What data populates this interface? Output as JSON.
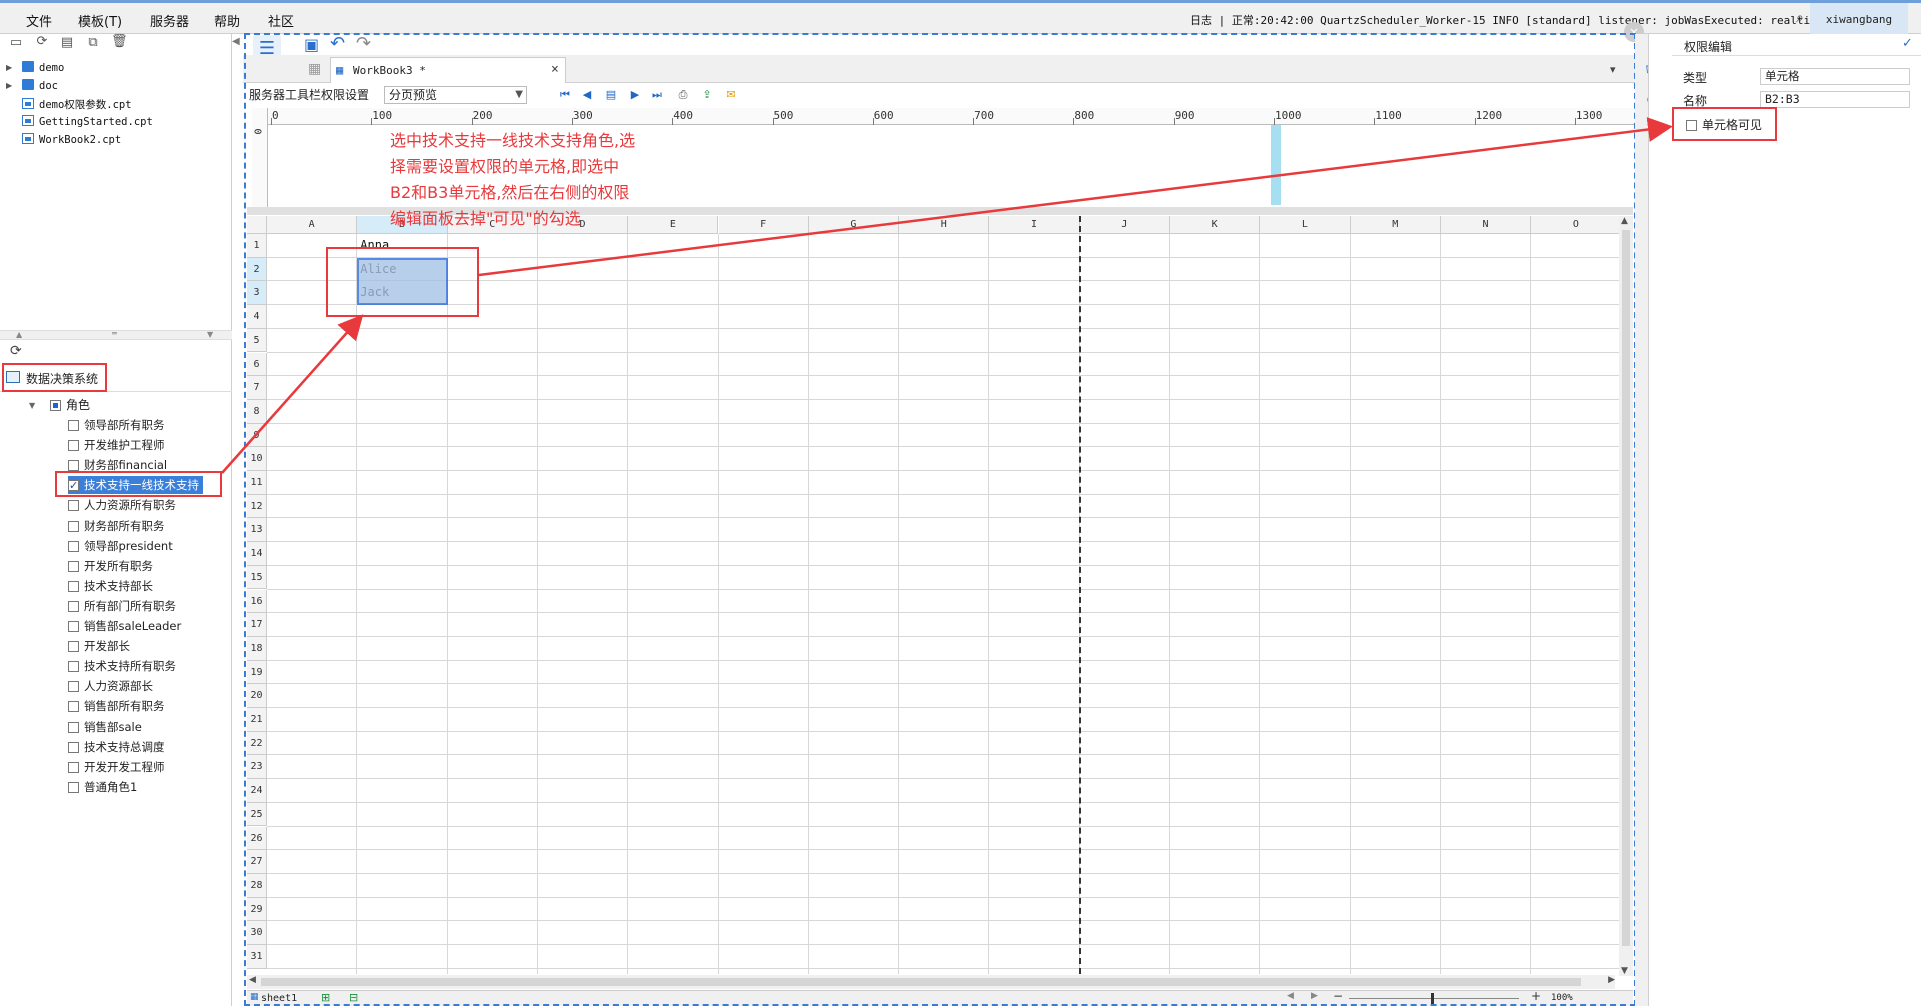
{
  "menu": [
    "文件",
    "模板(T)",
    "服务器",
    "帮助",
    "社区"
  ],
  "log": "日志 | 正常:20:42:00 QuartzScheduler_Worker-15 INFO [standard] listener: jobWasExecuted: realtime...",
  "user": "xiwangbang",
  "files": [
    {
      "name": "demo",
      "kind": "folder"
    },
    {
      "name": "doc",
      "kind": "folder"
    },
    {
      "name": "demo权限参数.cpt",
      "kind": "cpt"
    },
    {
      "name": "GettingStarted.cpt",
      "kind": "cpt"
    },
    {
      "name": "WorkBook2.cpt",
      "kind": "cpt"
    }
  ],
  "decision_system": "数据决策系统",
  "roles_root": "角色",
  "roles": [
    {
      "label": "领导部所有职务",
      "checked": false
    },
    {
      "label": "开发维护工程师",
      "checked": false
    },
    {
      "label": "财务部financial",
      "checked": false
    },
    {
      "label": "技术支持一线技术支持",
      "checked": true
    },
    {
      "label": "人力资源所有职务",
      "checked": false
    },
    {
      "label": "财务部所有职务",
      "checked": false
    },
    {
      "label": "领导部president",
      "checked": false
    },
    {
      "label": "开发所有职务",
      "checked": false
    },
    {
      "label": "技术支持部长",
      "checked": false
    },
    {
      "label": "所有部门所有职务",
      "checked": false
    },
    {
      "label": "销售部saleLeader",
      "checked": false
    },
    {
      "label": "开发部长",
      "checked": false
    },
    {
      "label": "技术支持所有职务",
      "checked": false
    },
    {
      "label": "人力资源部长",
      "checked": false
    },
    {
      "label": "销售部所有职务",
      "checked": false
    },
    {
      "label": "销售部sale",
      "checked": false
    },
    {
      "label": "技术支持总调度",
      "checked": false
    },
    {
      "label": "开发开发工程师",
      "checked": false
    },
    {
      "label": "普通角色1",
      "checked": false
    }
  ],
  "tab": {
    "title": "WorkBook3 *",
    "close": "×"
  },
  "perm_bar": {
    "label": "服务器工具栏权限设置",
    "select": "分页预览"
  },
  "ruler": [
    "0",
    "100",
    "200",
    "300",
    "400",
    "500",
    "600",
    "700",
    "800",
    "900",
    "1000",
    "1100",
    "1200",
    "1300"
  ],
  "columns": [
    "A",
    "B",
    "C",
    "D",
    "E",
    "F",
    "G",
    "H",
    "I",
    "J",
    "K",
    "L",
    "M",
    "N",
    "O"
  ],
  "rows": [
    "1",
    "2",
    "3",
    "4",
    "5",
    "6",
    "7",
    "8",
    "9",
    "10",
    "11",
    "12",
    "13",
    "14",
    "15",
    "16",
    "17",
    "18",
    "19",
    "20",
    "21",
    "22",
    "23",
    "24",
    "25",
    "26",
    "27",
    "28",
    "29",
    "30",
    "31"
  ],
  "cells": {
    "B1": "Anna",
    "B2": "Alice",
    "B3": "Jack"
  },
  "annotation": "选中技术支持一线技术支持角色,选\n择需要设置权限的单元格,即选中\nB2和B3单元格,然后在右侧的权限\n编辑面板去掉\"可见\"的勾选",
  "sheet_tab": "sheet1",
  "zoom": "100%",
  "right_panel": {
    "title": "权限编辑",
    "type_label": "类型",
    "type_value": "单元格",
    "name_label": "名称",
    "name_value": "B2:B3",
    "visible_label": "单元格可见"
  }
}
